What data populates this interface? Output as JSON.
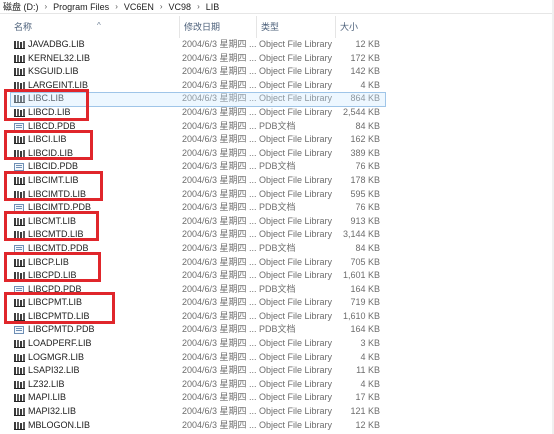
{
  "breadcrumb": {
    "items": [
      "磁盘 (D:)",
      "Program Files",
      "VC6EN",
      "VC98",
      "LIB"
    ],
    "separator": "›"
  },
  "columns": {
    "name": "名称",
    "date": "修改日期",
    "type": "类型",
    "size": "大小"
  },
  "files": [
    {
      "name": "JAVADBG.LIB",
      "date": "2004/6/3 星期四 ...",
      "type": "Object File Library",
      "size": "12 KB",
      "icon": "lib-file-icon"
    },
    {
      "name": "KERNEL32.LIB",
      "date": "2004/6/3 星期四 ...",
      "type": "Object File Library",
      "size": "172 KB",
      "icon": "lib-file-icon"
    },
    {
      "name": "KSGUID.LIB",
      "date": "2004/6/3 星期四 ...",
      "type": "Object File Library",
      "size": "142 KB",
      "icon": "lib-file-icon"
    },
    {
      "name": "LARGEINT.LIB",
      "date": "2004/6/3 星期四 ...",
      "type": "Object File Library",
      "size": "4 KB",
      "icon": "lib-file-icon"
    },
    {
      "name": "LIBC.LIB",
      "date": "2004/6/3 星期四 ...",
      "type": "Object File Library",
      "size": "864 KB",
      "icon": "lib-file-icon"
    },
    {
      "name": "LIBCD.LIB",
      "date": "2004/6/3 星期四 ...",
      "type": "Object File Library",
      "size": "2,544 KB",
      "icon": "lib-file-icon"
    },
    {
      "name": "LIBCD.PDB",
      "date": "2004/6/3 星期四 ...",
      "type": "PDB文档",
      "size": "84 KB",
      "icon": "pdb-file-icon"
    },
    {
      "name": "LIBCI.LIB",
      "date": "2004/6/3 星期四 ...",
      "type": "Object File Library",
      "size": "162 KB",
      "icon": "lib-file-icon"
    },
    {
      "name": "LIBCID.LIB",
      "date": "2004/6/3 星期四 ...",
      "type": "Object File Library",
      "size": "389 KB",
      "icon": "lib-file-icon"
    },
    {
      "name": "LIBCID.PDB",
      "date": "2004/6/3 星期四 ...",
      "type": "PDB文档",
      "size": "76 KB",
      "icon": "pdb-file-icon"
    },
    {
      "name": "LIBCIMT.LIB",
      "date": "2004/6/3 星期四 ...",
      "type": "Object File Library",
      "size": "178 KB",
      "icon": "lib-file-icon"
    },
    {
      "name": "LIBCIMTD.LIB",
      "date": "2004/6/3 星期四 ...",
      "type": "Object File Library",
      "size": "595 KB",
      "icon": "lib-file-icon"
    },
    {
      "name": "LIBCIMTD.PDB",
      "date": "2004/6/3 星期四 ...",
      "type": "PDB文档",
      "size": "76 KB",
      "icon": "pdb-file-icon"
    },
    {
      "name": "LIBCMT.LIB",
      "date": "2004/6/3 星期四 ...",
      "type": "Object File Library",
      "size": "913 KB",
      "icon": "lib-file-icon"
    },
    {
      "name": "LIBCMTD.LIB",
      "date": "2004/6/3 星期四 ...",
      "type": "Object File Library",
      "size": "3,144 KB",
      "icon": "lib-file-icon"
    },
    {
      "name": "LIBCMTD.PDB",
      "date": "2004/6/3 星期四 ...",
      "type": "PDB文档",
      "size": "84 KB",
      "icon": "pdb-file-icon"
    },
    {
      "name": "LIBCP.LIB",
      "date": "2004/6/3 星期四 ...",
      "type": "Object File Library",
      "size": "705 KB",
      "icon": "lib-file-icon"
    },
    {
      "name": "LIBCPD.LIB",
      "date": "2004/6/3 星期四 ...",
      "type": "Object File Library",
      "size": "1,601 KB",
      "icon": "lib-file-icon"
    },
    {
      "name": "LIBCPD.PDB",
      "date": "2004/6/3 星期四 ...",
      "type": "PDB文档",
      "size": "164 KB",
      "icon": "pdb-file-icon"
    },
    {
      "name": "LIBCPMT.LIB",
      "date": "2004/6/3 星期四 ...",
      "type": "Object File Library",
      "size": "719 KB",
      "icon": "lib-file-icon"
    },
    {
      "name": "LIBCPMTD.LIB",
      "date": "2004/6/3 星期四 ...",
      "type": "Object File Library",
      "size": "1,610 KB",
      "icon": "lib-file-icon"
    },
    {
      "name": "LIBCPMTD.PDB",
      "date": "2004/6/3 星期四 ...",
      "type": "PDB文档",
      "size": "164 KB",
      "icon": "pdb-file-icon"
    },
    {
      "name": "LOADPERF.LIB",
      "date": "2004/6/3 星期四 ...",
      "type": "Object File Library",
      "size": "3 KB",
      "icon": "lib-file-icon"
    },
    {
      "name": "LOGMGR.LIB",
      "date": "2004/6/3 星期四 ...",
      "type": "Object File Library",
      "size": "4 KB",
      "icon": "lib-file-icon"
    },
    {
      "name": "LSAPI32.LIB",
      "date": "2004/6/3 星期四 ...",
      "type": "Object File Library",
      "size": "11 KB",
      "icon": "lib-file-icon"
    },
    {
      "name": "LZ32.LIB",
      "date": "2004/6/3 星期四 ...",
      "type": "Object File Library",
      "size": "4 KB",
      "icon": "lib-file-icon"
    },
    {
      "name": "MAPI.LIB",
      "date": "2004/6/3 星期四 ...",
      "type": "Object File Library",
      "size": "17 KB",
      "icon": "lib-file-icon"
    },
    {
      "name": "MAPI32.LIB",
      "date": "2004/6/3 星期四 ...",
      "type": "Object File Library",
      "size": "121 KB",
      "icon": "lib-file-icon"
    },
    {
      "name": "MBLOGON.LIB",
      "date": "2004/6/3 星期四 ...",
      "type": "Object File Library",
      "size": "12 KB",
      "icon": "lib-file-icon"
    }
  ],
  "selected_file": "LIBC.LIB",
  "annotation_color": "#e0262b"
}
